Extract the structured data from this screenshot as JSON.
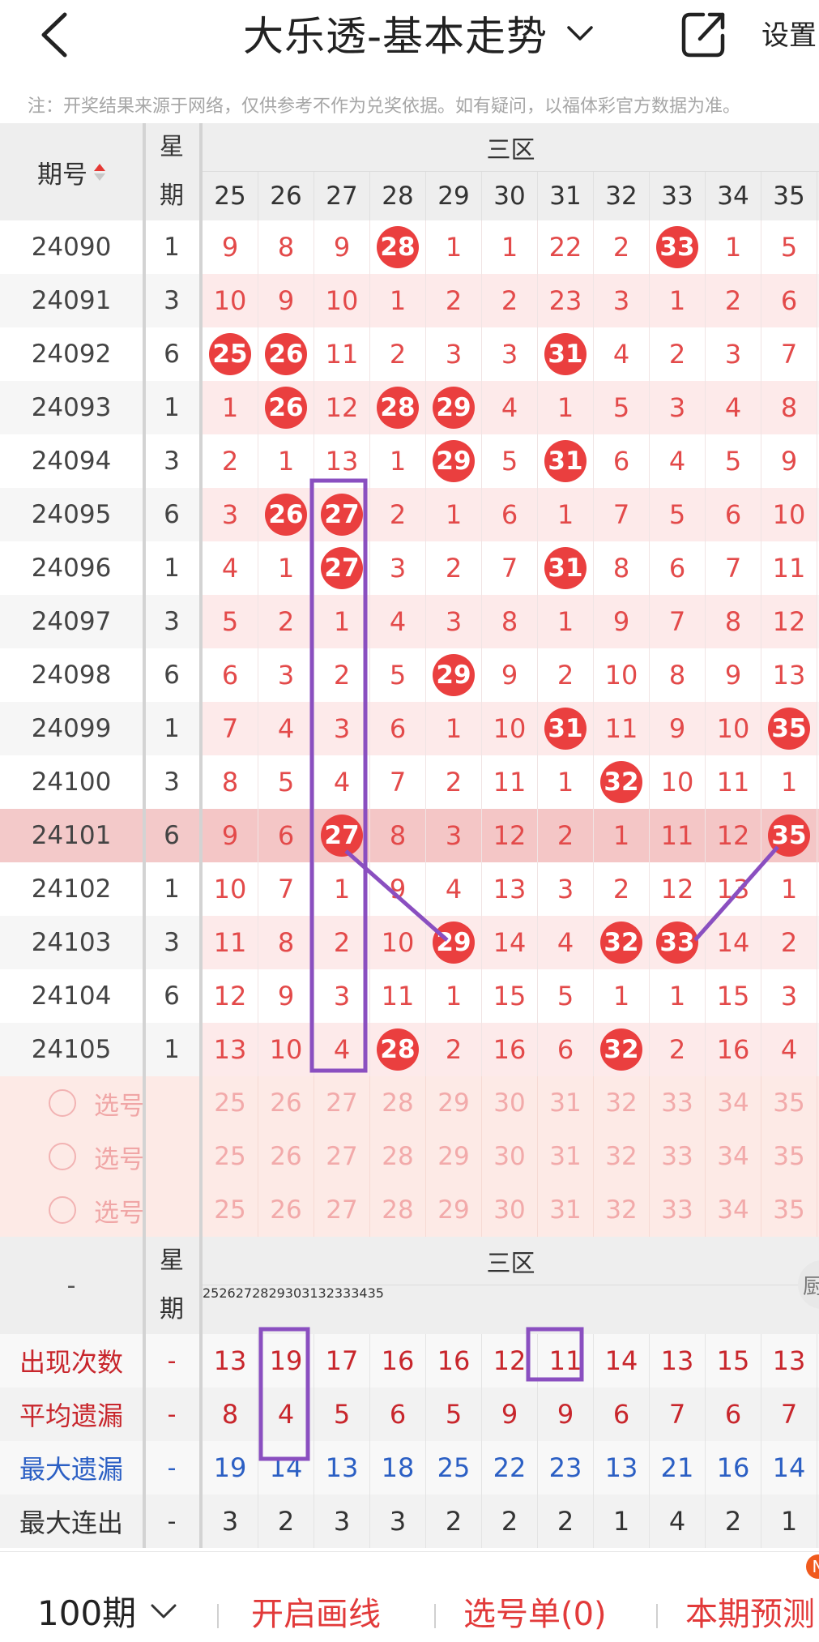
{
  "header": {
    "back_icon": "chevron-left-icon",
    "title": "大乐透-基本走势",
    "title_dropdown_icon": "chevron-down-icon",
    "share_icon": "share-external-icon",
    "settings_label": "设置"
  },
  "notice": "注：开奖结果来源于网络，仅供参考不作为兑奖依据。如有疑问，以福体彩官方数据为准。",
  "table": {
    "issue_header": "期号",
    "week_header_top": "星",
    "week_header_bottom": "期",
    "zone_header": "三区",
    "columns": [
      "25",
      "26",
      "27",
      "28",
      "29",
      "30",
      "31",
      "32",
      "33",
      "34",
      "35"
    ],
    "rows": [
      {
        "issue": "24090",
        "week": "1",
        "cells": [
          "9",
          "8",
          "9",
          "28",
          "1",
          "1",
          "22",
          "2",
          "33",
          "1",
          "5"
        ],
        "balls": [
          3,
          8
        ]
      },
      {
        "issue": "24091",
        "week": "3",
        "cells": [
          "10",
          "9",
          "10",
          "1",
          "2",
          "2",
          "23",
          "3",
          "1",
          "2",
          "6"
        ],
        "balls": []
      },
      {
        "issue": "24092",
        "week": "6",
        "cells": [
          "25",
          "26",
          "11",
          "2",
          "3",
          "3",
          "31",
          "4",
          "2",
          "3",
          "7"
        ],
        "balls": [
          0,
          1,
          6
        ]
      },
      {
        "issue": "24093",
        "week": "1",
        "cells": [
          "1",
          "26",
          "12",
          "28",
          "29",
          "4",
          "1",
          "5",
          "3",
          "4",
          "8"
        ],
        "balls": [
          1,
          3,
          4
        ]
      },
      {
        "issue": "24094",
        "week": "3",
        "cells": [
          "2",
          "1",
          "13",
          "1",
          "29",
          "5",
          "31",
          "6",
          "4",
          "5",
          "9"
        ],
        "balls": [
          4,
          6
        ]
      },
      {
        "issue": "24095",
        "week": "6",
        "cells": [
          "3",
          "26",
          "27",
          "2",
          "1",
          "6",
          "1",
          "7",
          "5",
          "6",
          "10"
        ],
        "balls": [
          1,
          2
        ]
      },
      {
        "issue": "24096",
        "week": "1",
        "cells": [
          "4",
          "1",
          "27",
          "3",
          "2",
          "7",
          "31",
          "8",
          "6",
          "7",
          "11"
        ],
        "balls": [
          2,
          6
        ]
      },
      {
        "issue": "24097",
        "week": "3",
        "cells": [
          "5",
          "2",
          "1",
          "4",
          "3",
          "8",
          "1",
          "9",
          "7",
          "8",
          "12"
        ],
        "balls": []
      },
      {
        "issue": "24098",
        "week": "6",
        "cells": [
          "6",
          "3",
          "2",
          "5",
          "29",
          "9",
          "2",
          "10",
          "8",
          "9",
          "13"
        ],
        "balls": [
          4
        ]
      },
      {
        "issue": "24099",
        "week": "1",
        "cells": [
          "7",
          "4",
          "3",
          "6",
          "1",
          "10",
          "31",
          "11",
          "9",
          "10",
          "35"
        ],
        "balls": [
          6,
          10
        ]
      },
      {
        "issue": "24100",
        "week": "3",
        "cells": [
          "8",
          "5",
          "4",
          "7",
          "2",
          "11",
          "1",
          "32",
          "10",
          "11",
          "1"
        ],
        "balls": [
          7
        ]
      },
      {
        "issue": "24101",
        "week": "6",
        "cells": [
          "9",
          "6",
          "27",
          "8",
          "3",
          "12",
          "2",
          "1",
          "11",
          "12",
          "35"
        ],
        "balls": [
          2,
          10
        ],
        "highlight": true
      },
      {
        "issue": "24102",
        "week": "1",
        "cells": [
          "10",
          "7",
          "1",
          "9",
          "4",
          "13",
          "3",
          "2",
          "12",
          "13",
          "1"
        ],
        "balls": []
      },
      {
        "issue": "24103",
        "week": "3",
        "cells": [
          "11",
          "8",
          "2",
          "10",
          "29",
          "14",
          "4",
          "32",
          "33",
          "14",
          "2"
        ],
        "balls": [
          4,
          7,
          8
        ]
      },
      {
        "issue": "24104",
        "week": "6",
        "cells": [
          "12",
          "9",
          "3",
          "11",
          "1",
          "15",
          "5",
          "1",
          "1",
          "15",
          "3"
        ],
        "balls": []
      },
      {
        "issue": "24105",
        "week": "1",
        "cells": [
          "13",
          "10",
          "4",
          "28",
          "2",
          "16",
          "6",
          "32",
          "2",
          "16",
          "4"
        ],
        "balls": [
          3,
          7
        ]
      }
    ],
    "pick_label": "选号",
    "pick_rows": 3
  },
  "stats": {
    "issue_header": "-",
    "week_header_top": "星",
    "week_header_bottom": "期",
    "zone_header": "三区",
    "rows": [
      {
        "label": "出现次数",
        "week": "-",
        "values": [
          "13",
          "19",
          "17",
          "16",
          "16",
          "12",
          "11",
          "14",
          "13",
          "15",
          "13"
        ],
        "color": "red"
      },
      {
        "label": "平均遗漏",
        "week": "-",
        "values": [
          "8",
          "4",
          "5",
          "6",
          "5",
          "9",
          "9",
          "6",
          "7",
          "6",
          "7"
        ],
        "color": "red"
      },
      {
        "label": "最大遗漏",
        "week": "-",
        "values": [
          "19",
          "14",
          "13",
          "18",
          "25",
          "22",
          "23",
          "13",
          "21",
          "16",
          "14"
        ],
        "color": "blue"
      },
      {
        "label": "最大连出",
        "week": "-",
        "values": [
          "3",
          "2",
          "3",
          "3",
          "2",
          "2",
          "2",
          "1",
          "4",
          "2",
          "1"
        ],
        "color": "dark"
      }
    ]
  },
  "side_tab_label": "厨",
  "bottom_bar": {
    "period_label": "100期",
    "period_dropdown_icon": "chevron-down-icon",
    "draw_line_label": "开启画线",
    "pick_list_label": "选号单(0)",
    "predict_label": "本期预测",
    "badge_label": "N"
  },
  "colors": {
    "ball": "#ea3f3f",
    "miss_number": "#e34a4a",
    "annotation": "#8a4fc0",
    "highlight_row": "#f6cccc"
  }
}
